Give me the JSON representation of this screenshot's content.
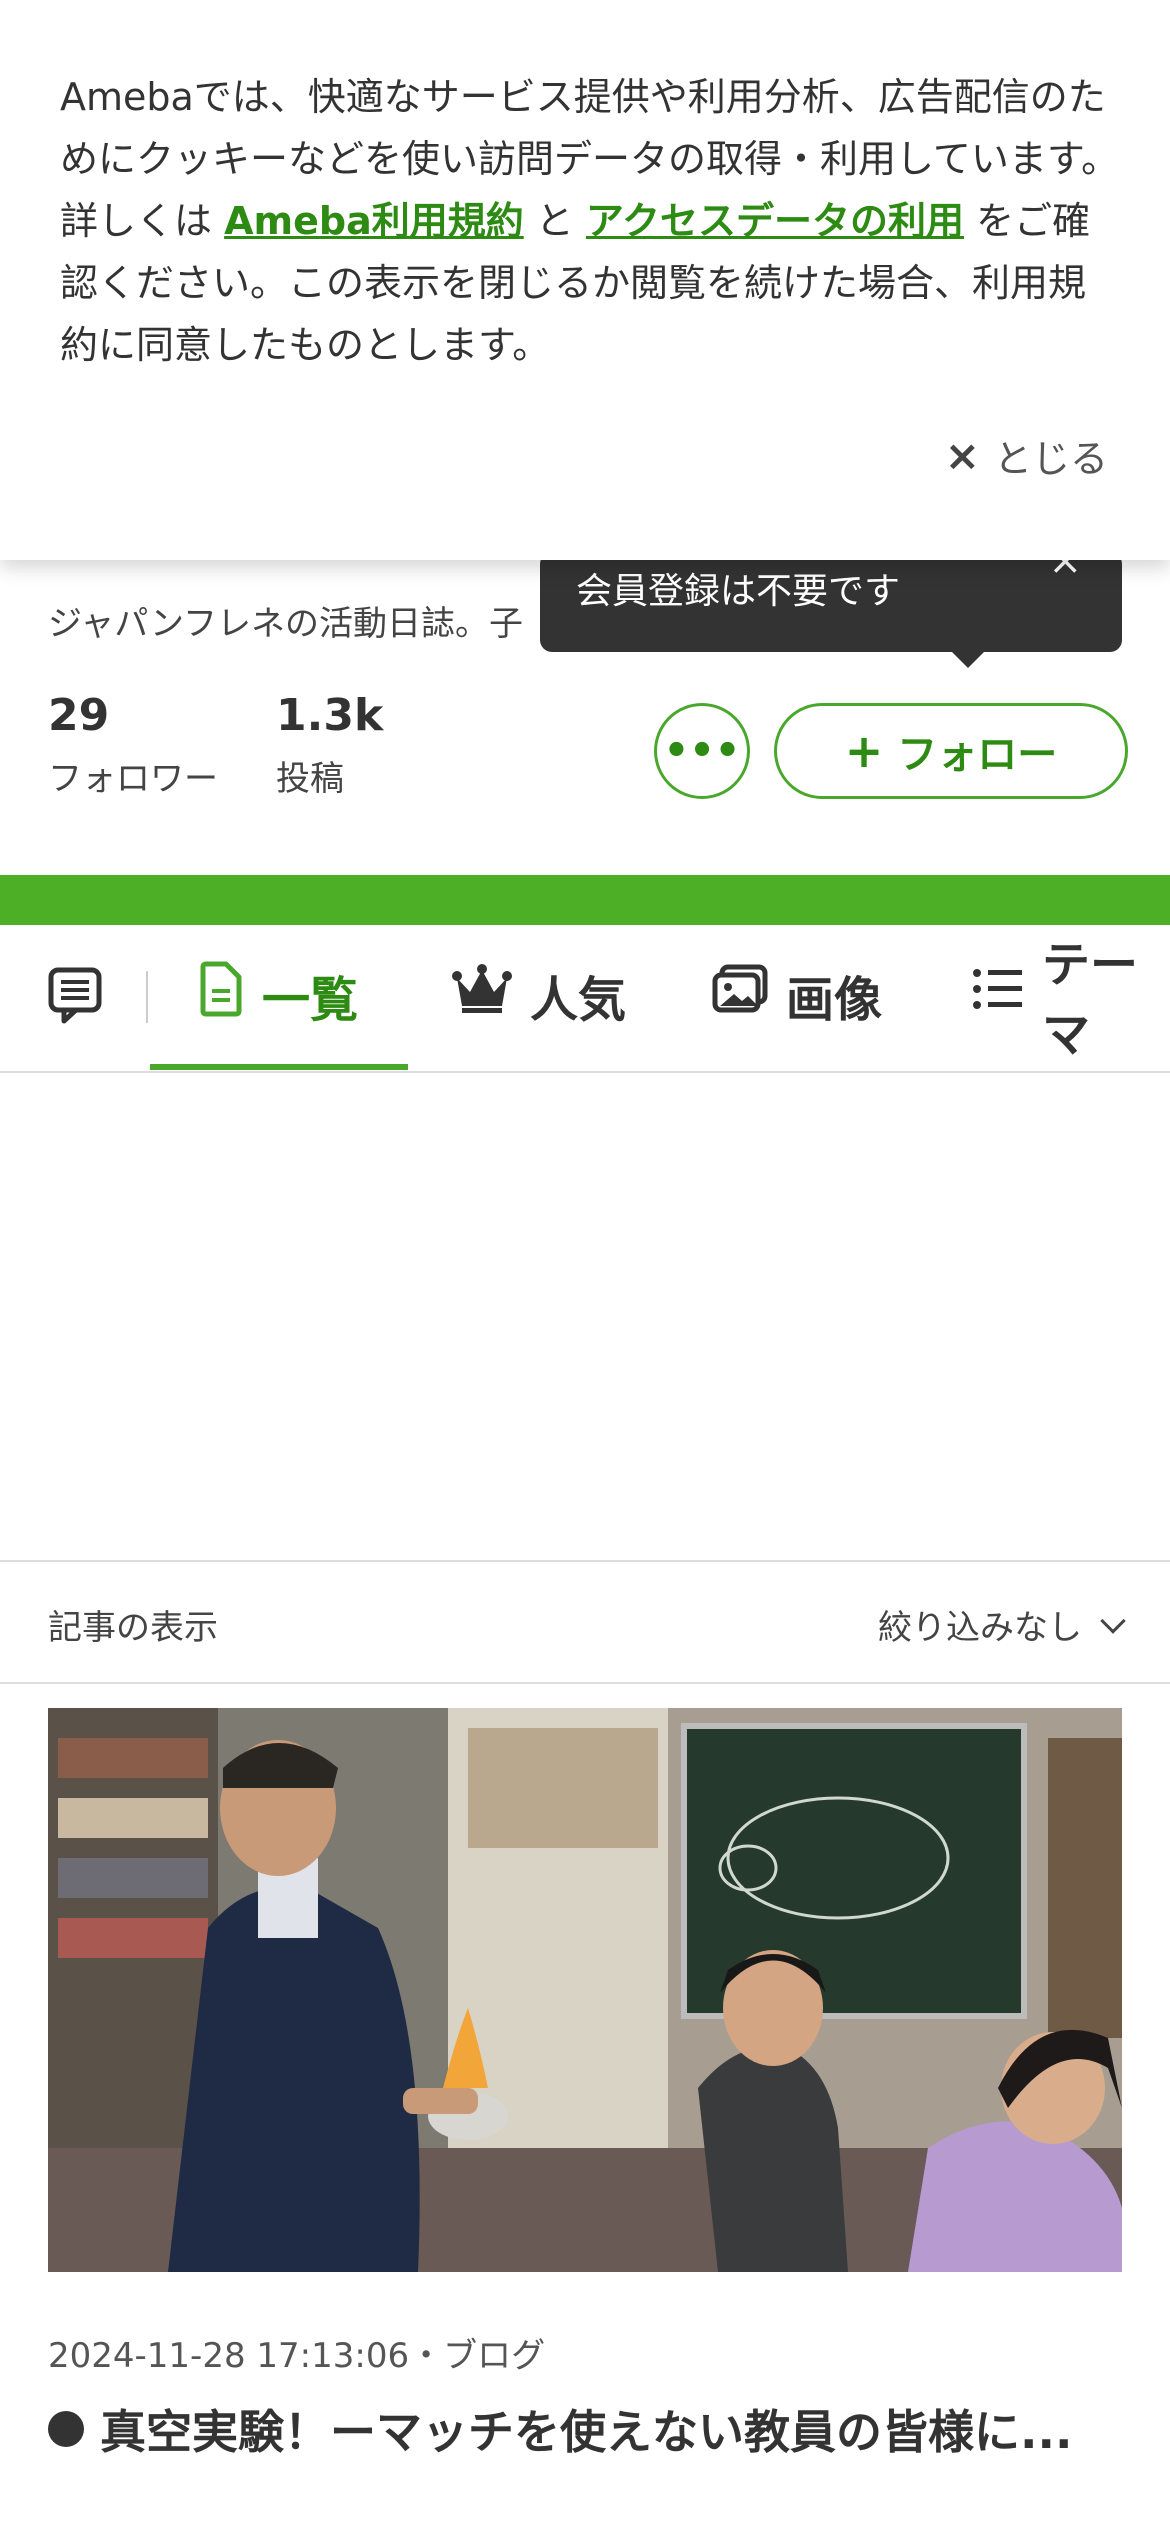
{
  "cookie_banner": {
    "text_1": "Amebaでは、快適なサービス提供や利用分析、広告配信のためにクッキーなどを使い訪問データの取得・利用しています。詳しくは ",
    "link_terms": "Ameba利用規約",
    "text_2": " と ",
    "link_access": "アクセスデータの利用",
    "text_3": " をご確認ください。この表示を閉じるか閲覧を続けた場合、利用規約に同意したものとします。",
    "close_icon": "×",
    "close_label": "とじる"
  },
  "profile": {
    "description": "ジャパンフレネの活動日誌。子",
    "followers_count": "29",
    "followers_label": "フォロワー",
    "posts_count": "1.3k",
    "posts_label": "投稿",
    "more_label": "•••",
    "follow_plus": "+",
    "follow_label": "フォロー"
  },
  "tooltip": {
    "text": "会員登録は不要です",
    "close_icon": "×"
  },
  "tabs": [
    {
      "label": "一覧",
      "icon": "document-icon",
      "active": true
    },
    {
      "label": "人気",
      "icon": "crown-icon",
      "active": false
    },
    {
      "label": "画像",
      "icon": "image-icon",
      "active": false
    },
    {
      "label": "テーマ",
      "icon": "list-icon",
      "active": false
    }
  ],
  "filter": {
    "label": "記事の表示",
    "selected": "絞り込みなし"
  },
  "article": {
    "meta": "2024-11-28 17:13:06・ブログ",
    "title": "真空実験！ーマッチを使えない教員の皆様に..."
  },
  "colors": {
    "accent": "#2d8a13",
    "brand_green": "#4caf26",
    "tooltip_bg": "#333333"
  }
}
